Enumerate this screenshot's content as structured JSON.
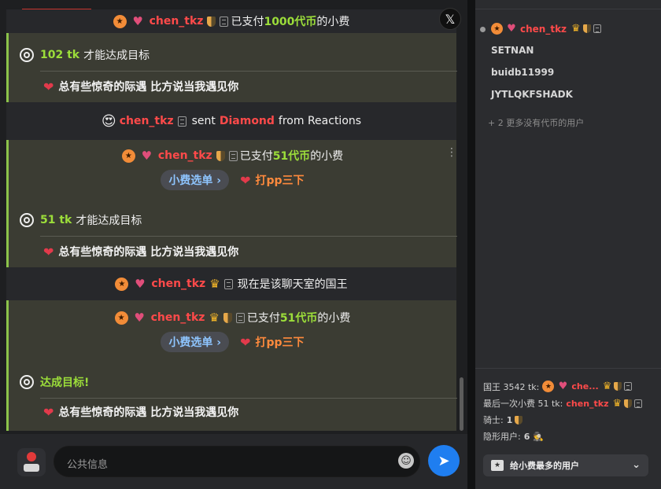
{
  "chat": {
    "top_tip": {
      "user": "chen_tkz",
      "text_pre": "已支付",
      "amount": "1000代币",
      "text_post": "的小费"
    },
    "goal1": {
      "tk": "102 tk",
      "text": "才能达成目标",
      "wish": "总有些惊奇的际遇 比方说当我遇见你"
    },
    "reaction": {
      "emoji": "😍",
      "user": "chen_tkz",
      "text_pre": "sent",
      "item": "Diamond",
      "text_post": "from Reactions"
    },
    "tip2": {
      "user": "chen_tkz",
      "text_pre": "已支付",
      "amount": "51代币",
      "text_post": "的小费",
      "menu_label": "小费选单",
      "menu_item": "打pp三下"
    },
    "goal2": {
      "tk": "51 tk",
      "text": "才能达成目标",
      "wish": "总有些惊奇的际遇 比方说当我遇见你"
    },
    "king": {
      "user": "chen_tkz",
      "text": "现在是该聊天室的国王"
    },
    "tip3": {
      "user": "chen_tkz",
      "text_pre": "已支付",
      "amount": "51代币",
      "text_post": "的小费",
      "menu_label": "小费选单",
      "menu_item": "打pp三下"
    },
    "goal3": {
      "text": "达成目标!",
      "wish": "总有些惊奇的际遇 比方说当我遇见你"
    },
    "placeholder": "公共信息"
  },
  "sidebar": {
    "users": [
      {
        "name": "chen_tkz"
      },
      {
        "name": "SETNAN"
      },
      {
        "name": "buidb11999"
      },
      {
        "name": "JYTLQKFSHADK"
      }
    ],
    "more_users": "+ 2 更多没有代币的用户",
    "king_label": "国王 3542 tk:",
    "king_name": "che...",
    "last_tip_label": "最后一次小费 51 tk:",
    "last_tip_name": "chen_tkz",
    "knights_label": "骑士:",
    "knights_count": "1",
    "hidden_label": "隐形用户:",
    "hidden_count": "6",
    "top_tipper_button": "给小费最多的用户"
  },
  "colors": {
    "accent": "#1f7ef0",
    "goal_green": "#9cde3a",
    "username_red": "#ff4a4a",
    "tip_orange": "#ff8a3d"
  }
}
